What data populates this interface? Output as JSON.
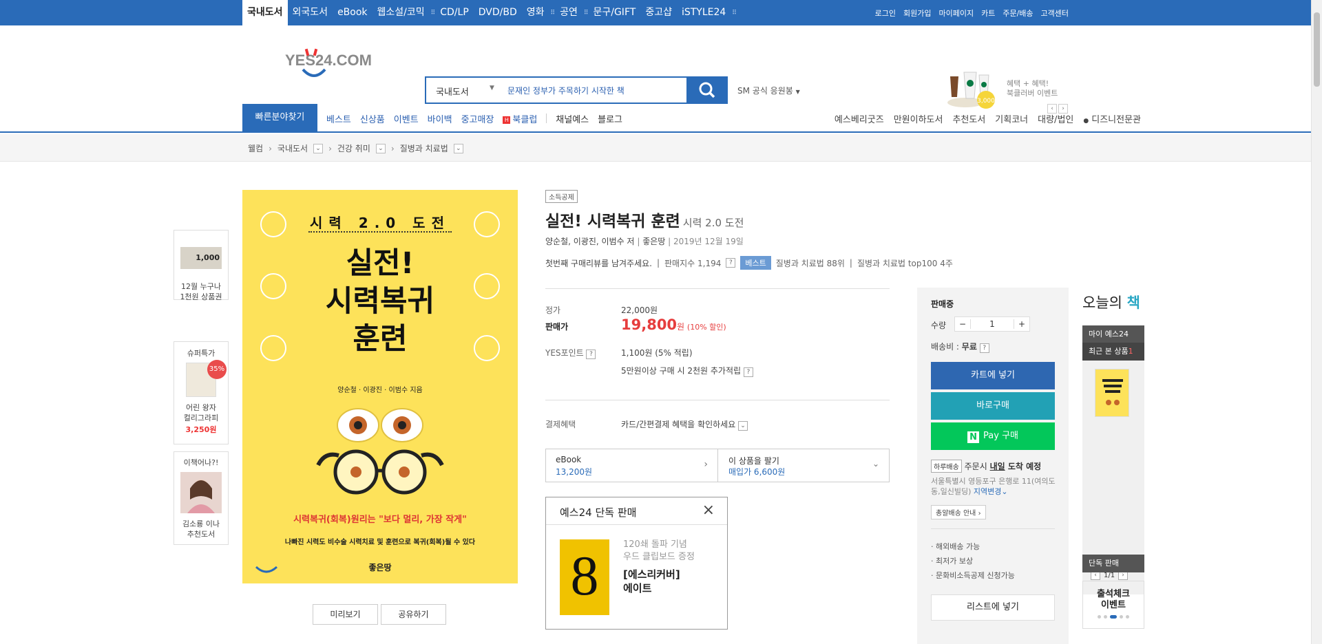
{
  "topnav": {
    "items": [
      "국내도서",
      "외국도서",
      "eBook",
      "웹소설/코믹",
      "CD/LP",
      "DVD/BD",
      "영화",
      "공연",
      "문구/GIFT",
      "중고샵",
      "iSTYLE24"
    ],
    "util": [
      "로그인",
      "회원가입",
      "마이페이지",
      "카트",
      "주문/배송",
      "고객센터"
    ]
  },
  "header": {
    "logo_text": "YES24.COM",
    "search_category": "국내도서",
    "search_value": "문재인 정부가 주목하기 시작한 책",
    "sm_label": "SM 공식 응원봉",
    "promo_line1": "혜택 + 혜택!",
    "promo_line2": "북클러버 이벤트",
    "promo_price": "3,000"
  },
  "gnb": {
    "quick": "빠른분야찾기",
    "left": [
      "베스트",
      "신상품",
      "이벤트",
      "바이백",
      "중고매장"
    ],
    "bookclub": "북클럽",
    "left2": [
      "채널예스",
      "블로그"
    ],
    "right": [
      "예스베리굿즈",
      "만원이하도서",
      "추천도서",
      "기획코너",
      "대량/법인",
      "디즈니전문관"
    ]
  },
  "breadcrumb": [
    "웰컴",
    "국내도서",
    "건강 취미",
    "질병과 치료법"
  ],
  "sideads": {
    "ad1": "12월 누구나\n1천원 상품권",
    "ad1_img": "1,000",
    "ad2_title": "슈퍼특가",
    "ad2_badge": "35%",
    "ad2_name": "어린 왕자\n컬리그라피",
    "ad2_price": "3,250원",
    "ad3_title": "이책어나?!",
    "ad3_name": "김소룡 이나\n추천도서"
  },
  "cover": {
    "line1": "시력 2.0 도전",
    "line2": "실전!\n시력복귀\n훈련",
    "authors": "양순철 · 이광진 · 이범수 지음",
    "tagline": "시력복귀(회복)원리는 \"보다 멀리, 가장 작게\"",
    "desc": "나빠진 시력도 비수술 시력치료 및 훈련으로 복귀(회복)될 수 있다",
    "publisher": "좋은땅"
  },
  "cover_buttons": [
    "미리보기",
    "공유하기"
  ],
  "product": {
    "tag": "소득공제",
    "title": "실전! 시력복귀 훈련",
    "subtitle": "시력 2.0 도전",
    "authors": "양순철, 이광진, 이범수 저",
    "publisher": "좋은땅",
    "date": "2019년 12월 19일",
    "review": "첫번째 구매리뷰를 남겨주세요.",
    "sales_index": "판매지수 1,194",
    "best_badge": "베스트",
    "rank1": "질병과 치료법 88위",
    "rank2": "질병과 치료법 top100 4주"
  },
  "price": {
    "list_label": "정가",
    "list_price": "22,000원",
    "sale_label": "판매가",
    "sale_price": "19,800",
    "sale_unit": "원",
    "discount": "(10% 할인)",
    "point_label": "YES포인트",
    "point": "1,100원 (5% 적립)",
    "extra_point": "5만원이상 구매 시 2천원 추가적립",
    "pay_label": "결제혜택",
    "pay_value": "카드/간편결제 혜택을 확인하세요"
  },
  "ebook": {
    "label": "eBook",
    "price": "13,200원",
    "sell_label": "이 상품을 팔기",
    "sell_price": "매입가 6,600원"
  },
  "exclusive": {
    "title": "예스24 단독 판매",
    "line1": "120쇄 돌파 기념",
    "line2": "우드 클립보드 증정",
    "line3": "[에스리커버]",
    "line4": "에이트"
  },
  "order": {
    "status": "판매중",
    "qty_label": "수량",
    "qty": "1",
    "ship_label": "배송비 : ",
    "ship_value": "무료",
    "cart": "카트에 넣기",
    "buy": "바로구매",
    "npay": "Pay 구매",
    "same_day_tag": "하루배송",
    "arrival": "주문시 ",
    "arrival_day": "내일",
    "arrival_suffix": " 도착 예정",
    "address": "서울특별시 영등포구 은행로 11(여의도동,일신빌딩)",
    "region_change": "지역변경",
    "guide": "총알배송 안내",
    "features": [
      "해외배송 가능",
      "최저가 보상",
      "문화비소득공제 신청가능"
    ],
    "list": "리스트에 넣기"
  },
  "today": {
    "title1": "오늘의",
    "title2": "책",
    "my": "마이 예스24",
    "recent": "최근 본 상품",
    "recent_count": "1",
    "page": "1/1",
    "exclusive": "단독 판매",
    "attend": "출석체크\n이벤트"
  }
}
